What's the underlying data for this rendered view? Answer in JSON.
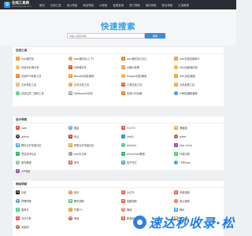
{
  "header": {
    "logo_mark": "Q",
    "logo_name": "在线工具网",
    "logo_url": "www.hkqxinet.com",
    "nav": [
      "首页",
      "在线工具",
      "设计导航",
      "网站导航",
      "AI导航",
      "各类查询",
      "热门导航",
      "娱乐导航",
      "职业导航",
      "汇英推荐"
    ]
  },
  "banner": {
    "title": "快速搜索",
    "search_placeholder": "请输入搜索内容",
    "search_button": "搜索"
  },
  "sections": [
    {
      "title": "在线工具",
      "items": [
        {
          "label": "Json格式化",
          "color": "#f39c12",
          "icon": "J"
        },
        {
          "label": "Json格式化(上下)",
          "color": "#e8a317",
          "icon": "J"
        },
        {
          "label": "Json格式化(左右)",
          "color": "#e67e22",
          "icon": "J"
        },
        {
          "label": "Json在线压缩转义",
          "color": "#f0a020",
          "icon": "J"
        },
        {
          "label": "在线XML格式化",
          "color": "#f5b041",
          "icon": "X"
        },
        {
          "label": "代码格式化",
          "color": "#e74c3c",
          "icon": "C"
        },
        {
          "label": "AI图片处理",
          "color": "#eb984e",
          "icon": "A"
        },
        {
          "label": "SQL压缩/格式化",
          "color": "#f5a623",
          "icon": "S"
        },
        {
          "label": "在线PDF转换工具",
          "color": "#e67e22",
          "icon": "P"
        },
        {
          "label": "Base64加密/解密",
          "color": "#f39c12",
          "icon": "B"
        },
        {
          "label": "Escape加密/解密",
          "color": "#f0a030",
          "icon": "E"
        },
        {
          "label": "URL加密/解密",
          "color": "#e8a317",
          "icon": "U"
        },
        {
          "label": "文本重复工具",
          "color": "#f0b27a",
          "icon": "T"
        },
        {
          "label": "文本去重工具",
          "color": "#f39c12",
          "icon": "T"
        },
        {
          "label": "汇英在线工具",
          "color": "#e74c3c",
          "icon": "H"
        },
        {
          "label": "文本处理工具",
          "color": "#f5a623",
          "icon": "T"
        },
        {
          "label": "在线生成二维码工具",
          "color": "#2ecc71",
          "icon": "Q"
        },
        {
          "label": "Websocket测试",
          "color": "#95a5a6",
          "icon": "W"
        },
        {
          "label": "在线CSS压缩",
          "color": "#e67e22",
          "icon": "C"
        },
        {
          "label": "IO网站编程客服",
          "color": "#3498db",
          "icon": "I"
        }
      ]
    },
    {
      "title": "设计导航",
      "items": [
        {
          "label": "csdn",
          "color": "#e74c3c",
          "icon": "C"
        },
        {
          "label": "掘金",
          "color": "#1e80ff",
          "icon": "掘"
        },
        {
          "label": "51CTO",
          "color": "#d9534f",
          "icon": "5"
        },
        {
          "label": "博客园",
          "color": "#f0a030",
          "icon": "博"
        },
        {
          "label": "github",
          "color": "#24292e",
          "icon": "G"
        },
        {
          "label": "码云",
          "color": "#c71d23",
          "icon": "码"
        },
        {
          "label": "InfoQ",
          "color": "#2c8bd3",
          "icon": "I"
        },
        {
          "label": "gitee",
          "color": "#c0392b",
          "icon": "g"
        },
        {
          "label": "腾讯云开发者社区",
          "color": "#3498db",
          "icon": "腾"
        },
        {
          "label": "阿里云开发者社区",
          "color": "#f39c12",
          "icon": "阿"
        },
        {
          "label": "oschina",
          "color": "#2ecc71",
          "icon": "o"
        },
        {
          "label": "php china",
          "color": "#8e44ad",
          "icon": "p"
        },
        {
          "label": "思否技术社区",
          "color": "#27ae60",
          "icon": "S"
        },
        {
          "label": "php中文网",
          "color": "#7f8c8d",
          "icon": "p"
        },
        {
          "label": "w3cschool教程",
          "color": "#27ae60",
          "icon": "w"
        },
        {
          "label": "开源中国",
          "color": "#2ecc71",
          "icon": "开"
        },
        {
          "label": "菜鸟教程",
          "color": "#5cb85c",
          "icon": "菜"
        },
        {
          "label": "简书",
          "color": "#e74c3c",
          "icon": "简"
        },
        {
          "label": "知乎专栏",
          "color": "#3498db",
          "icon": "知"
        },
        {
          "label": "飞书Docs",
          "color": "#3498db",
          "icon": "飞"
        },
        {
          "label": "ICP导航",
          "color": "#9b59b6",
          "icon": "I"
        }
      ]
    },
    {
      "title": "网站导航",
      "items": [
        {
          "label": "抖音",
          "color": "#111111",
          "icon": "抖"
        },
        {
          "label": "快手",
          "color": "#ff6b00",
          "icon": "快"
        },
        {
          "label": "小红书",
          "color": "#e74c3c",
          "icon": "红"
        },
        {
          "label": "好看视频",
          "color": "#e74c3c",
          "icon": "好"
        },
        {
          "label": "哔哩哔哩",
          "color": "#3498db",
          "icon": "B"
        },
        {
          "label": "腾讯视频",
          "color": "#2ecc71",
          "icon": "腾"
        },
        {
          "label": "优酷视频",
          "color": "#e74c3c",
          "icon": "优"
        },
        {
          "label": "西瓜视频",
          "color": "#e74c3c",
          "icon": "西"
        },
        {
          "label": "爱奇艺",
          "color": "#2ecc71",
          "icon": "爱"
        },
        {
          "label": "芒果TV",
          "color": "#f39c12",
          "icon": "芒"
        },
        {
          "label": "微博",
          "color": "#e74c3c",
          "icon": "微"
        },
        {
          "label": "腾讯",
          "color": "#3498db",
          "icon": "腾"
        },
        {
          "label": "今日头条",
          "color": "#e74c3c",
          "icon": "头"
        },
        {
          "label": "网易",
          "color": "#c0392b",
          "icon": "网"
        },
        {
          "label": "新浪网",
          "color": "#e74c3c",
          "icon": "新"
        },
        {
          "label": "搜狐网",
          "color": "#f39c12",
          "icon": "搜"
        },
        {
          "label": "凤凰网",
          "color": "#c0392b",
          "icon": "凤"
        }
      ]
    }
  ],
  "watermark": {
    "text": "速达秒收录·松"
  }
}
